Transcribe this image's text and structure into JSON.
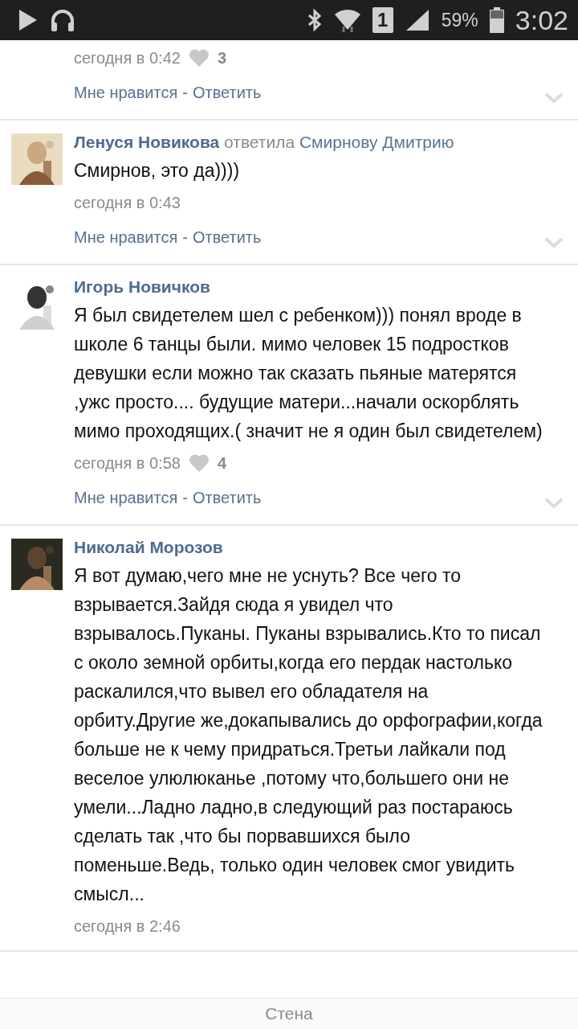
{
  "status_bar": {
    "sim": "1",
    "battery_text": "59%",
    "time": "3:02"
  },
  "comments": [
    {
      "time": "сегодня в 0:42",
      "likes": "3",
      "actions": {
        "like": "Мне нравится",
        "separator": "-",
        "reply": "Ответить"
      }
    },
    {
      "author": "Ленуся Новикова",
      "reply_verb": "ответила",
      "reply_to": "Смирнову Дмитрию",
      "text": "Смирнов, это да))))",
      "time": "сегодня в 0:43",
      "actions": {
        "like": "Мне нравится",
        "separator": "-",
        "reply": "Ответить"
      }
    },
    {
      "author": "Игорь Новичков",
      "text": "Я был свидетелем шел с ребенком))) понял вроде в школе 6 танцы были. мимо человек 15 подростков девушки если можно так сказать пьяные матерятся ,ужс просто.... будущие матери...начали оскорблять мимо проходящих.( значит не я один был свидетелем)",
      "time": "сегодня в 0:58",
      "likes": "4",
      "actions": {
        "like": "Мне нравится",
        "separator": "-",
        "reply": "Ответить"
      }
    },
    {
      "author": "Николай Морозов",
      "text": "Я вот думаю,чего мне не уснуть? Все чего то взрывается.Зайдя сюда я увидел что взрывалось.Пуканы. Пуканы взрывались.Кто то писал с около земной орбиты,когда его пердак настолько раскалился,что вывел его обладателя на орбиту.Другие же,докапывались до орфографии,когда больше не к чему придраться.Третьи лайкали под веселое улюлюканье ,потому что,большего они не умели...Ладно ладно,в следующий раз постараюсь сделать так ,что бы порвавшихся было поменьше.Ведь, только один человек смог увидить смысл...",
      "time": "сегодня в 2:46"
    }
  ],
  "bottom_bar": {
    "title": "Стена"
  }
}
